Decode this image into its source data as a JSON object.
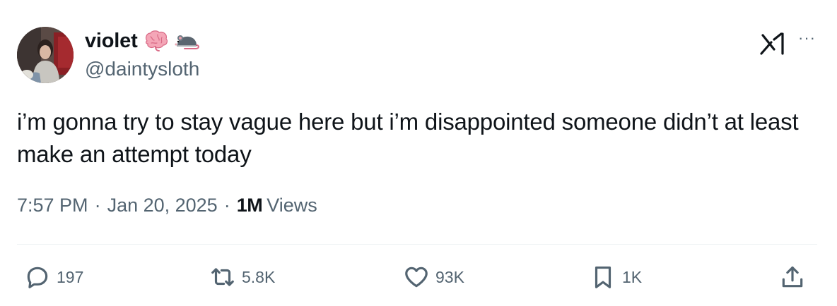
{
  "author": {
    "display_name": "violet",
    "handle": "@daintysloth",
    "name_emojis": [
      "brain-emoji",
      "rat-emoji"
    ]
  },
  "tweet": {
    "text": "i’m gonna try to stay vague here but i’m disappointed someone didn’t at least make an attempt today",
    "time": "7:57 PM",
    "separator": "·",
    "date": "Jan 20, 2025",
    "views_count": "1M",
    "views_label": "Views"
  },
  "actions": {
    "replies": "197",
    "reposts": "5.8K",
    "likes": "93K",
    "bookmarks": "1K"
  },
  "top_actions": {
    "more": "···"
  },
  "colors": {
    "text_primary": "#0f1419",
    "text_secondary": "#536471",
    "divider": "#eff3f4",
    "background": "#ffffff"
  },
  "icons": [
    "grok-icon",
    "more-icon",
    "reply-icon",
    "repost-icon",
    "like-icon",
    "bookmark-icon",
    "share-icon"
  ]
}
